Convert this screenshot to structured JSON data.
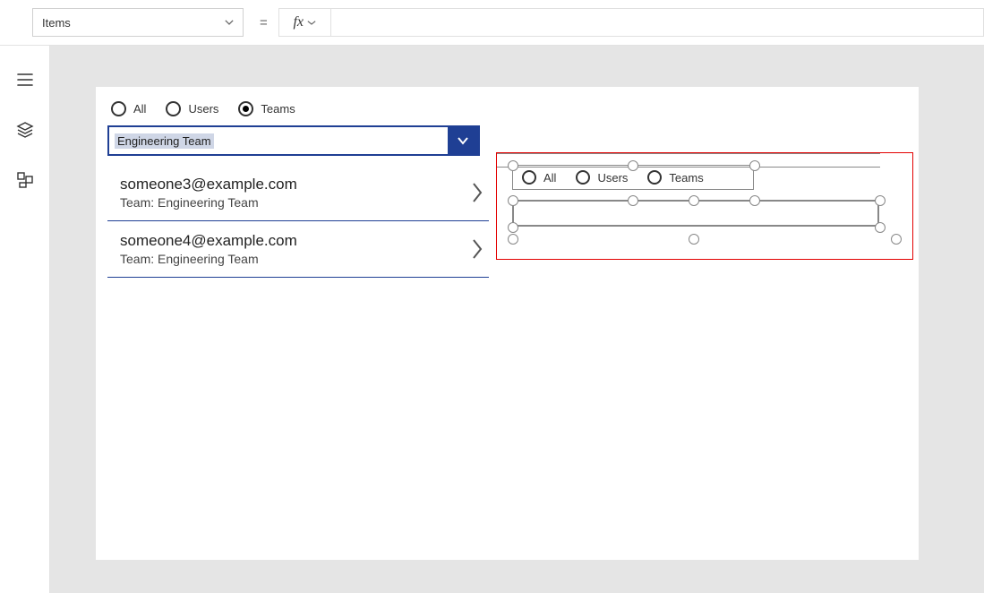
{
  "formula_bar": {
    "property": "Items",
    "equals": "=",
    "fx_label": "fx"
  },
  "tool_rail": {
    "icons": [
      "hamburger",
      "layers",
      "grid"
    ]
  },
  "screen_left": {
    "radios": {
      "all": "All",
      "users": "Users",
      "teams": "Teams",
      "selected": "teams"
    },
    "dropdown_value": "Engineering Team",
    "list": [
      {
        "title": "someone3@example.com",
        "sub": "Team: Engineering Team"
      },
      {
        "title": "someone4@example.com",
        "sub": "Team: Engineering Team"
      }
    ]
  },
  "designer": {
    "radios": {
      "all": "All",
      "users": "Users",
      "teams": "Teams"
    }
  }
}
